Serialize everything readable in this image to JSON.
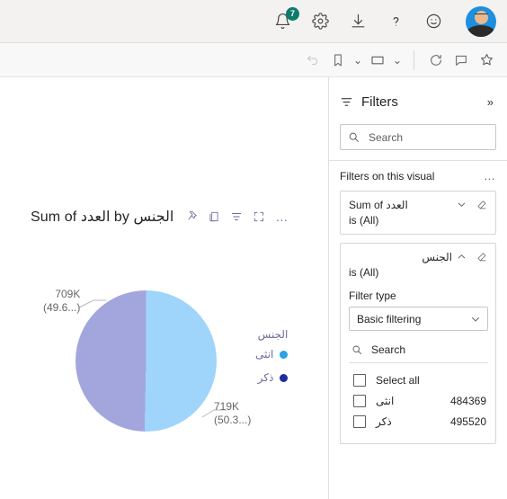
{
  "topbar": {
    "notifications_count": "7",
    "notifications_label": "Notifications",
    "settings_label": "Settings",
    "download_label": "Download",
    "help_label": "Help",
    "feedback_label": "Feedback",
    "account_label": "Account manager",
    "badge_color": "#0f7b6c"
  },
  "toolbar": {
    "undo_label": "Undo",
    "bookmarks_label": "Bookmarks",
    "bookmarks_chevron": "⌄",
    "view_label": "View",
    "view_chevron": "⌄",
    "refresh_label": "Refresh",
    "comment_label": "Comment",
    "favorite_label": "Favorite"
  },
  "visual": {
    "title": "Sum of العدد by الجنس",
    "header_icons": [
      {
        "name": "pin-icon",
        "label": "Pin to dashboard"
      },
      {
        "name": "copy-icon",
        "label": "Copy visual"
      },
      {
        "name": "filter-icon",
        "label": "Filters"
      },
      {
        "name": "focus-mode-icon",
        "label": "Focus mode"
      },
      {
        "name": "more-options-icon",
        "label": "More options",
        "glyph": "…"
      }
    ]
  },
  "chart_data": {
    "type": "pie",
    "title": "Sum of العدد by الجنس",
    "legend_title": "الجنس",
    "legend_position": "right",
    "categories": [
      "انثى",
      "ذكر"
    ],
    "values": [
      719000,
      709000
    ],
    "percentages": [
      50.3,
      49.6
    ],
    "colors": [
      "#9fd4fb",
      "#a3a6dd"
    ],
    "data_labels": [
      {
        "category": "ذكر",
        "value_text": "709K",
        "percent_text": "(49.6...)",
        "color": "#a3a6dd",
        "position": "left"
      },
      {
        "category": "انثى",
        "value_text": "719K",
        "percent_text": "(50.3...)",
        "color": "#9fd4fb",
        "position": "right"
      }
    ],
    "legend_entries": [
      {
        "label": "انثى",
        "color": "#2aa1ea"
      },
      {
        "label": "ذكر",
        "color": "#1f2c9e"
      }
    ]
  },
  "filters": {
    "title": "Filters",
    "expand_glyph": "»",
    "search": {
      "placeholder": "Search",
      "value": ""
    },
    "section_title": "Filters on this visual",
    "section_more": "…",
    "cards": [
      {
        "name": "Sum of العدد",
        "condition": "is (All)",
        "expanded": false,
        "chevron": "⌄"
      },
      {
        "name": "الجنس",
        "condition": "is (All)",
        "expanded": true,
        "chevron": "⌃",
        "filter_type_label": "Filter type",
        "filter_type_value": "Basic filtering",
        "filter_type_chevron": "⌄",
        "inner_search_placeholder": "Search",
        "options": [
          {
            "label": "Select all",
            "count": "",
            "checked": false
          },
          {
            "label": "انثى",
            "count": "484369",
            "checked": false
          },
          {
            "label": "ذكر",
            "count": "495520",
            "checked": false
          }
        ]
      }
    ]
  }
}
